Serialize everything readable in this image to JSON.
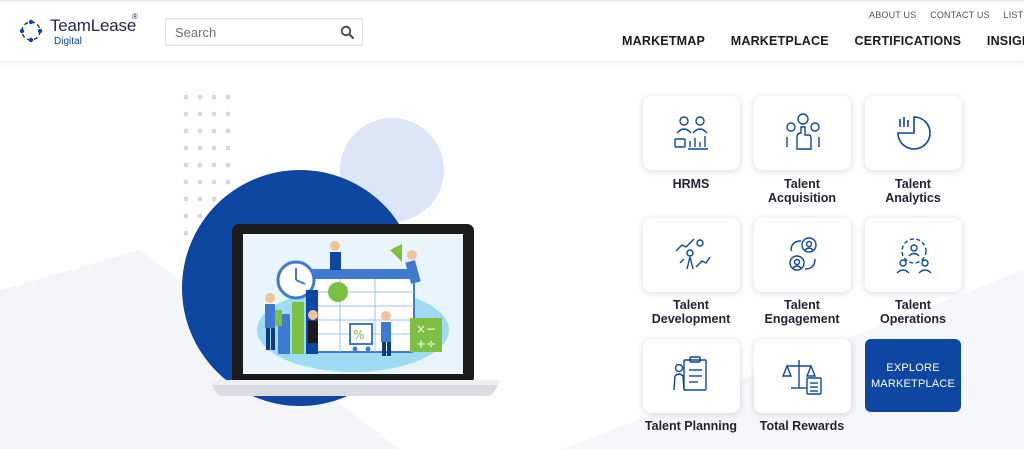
{
  "brand": {
    "name": "TeamLease",
    "sub": "Digital",
    "reg": "®"
  },
  "search": {
    "placeholder": "Search"
  },
  "top_links": [
    "ABOUT US",
    "CONTACT US",
    "LIST YO"
  ],
  "nav": [
    "MARKETMAP",
    "MARKETPLACE",
    "CERTIFICATIONS",
    "INSIGHTS"
  ],
  "tiles": [
    {
      "label": "HRMS",
      "icon": "hrms-icon"
    },
    {
      "label": "Talent Acquisition",
      "icon": "talent-acquisition-icon"
    },
    {
      "label": "Talent Analytics",
      "icon": "talent-analytics-icon"
    },
    {
      "label": "Talent Development",
      "icon": "talent-development-icon"
    },
    {
      "label": "Talent Engagement",
      "icon": "talent-engagement-icon"
    },
    {
      "label": "Talent Operations",
      "icon": "talent-operations-icon"
    },
    {
      "label": "Talent Planning",
      "icon": "talent-planning-icon"
    },
    {
      "label": "Total Rewards",
      "icon": "total-rewards-icon"
    }
  ],
  "explore": {
    "line1": "EXPLORE",
    "line2": "MARKETPLACE"
  },
  "colors": {
    "brand_blue": "#0d47a1",
    "light_blue": "#dde6f7",
    "green": "#7bc043"
  }
}
